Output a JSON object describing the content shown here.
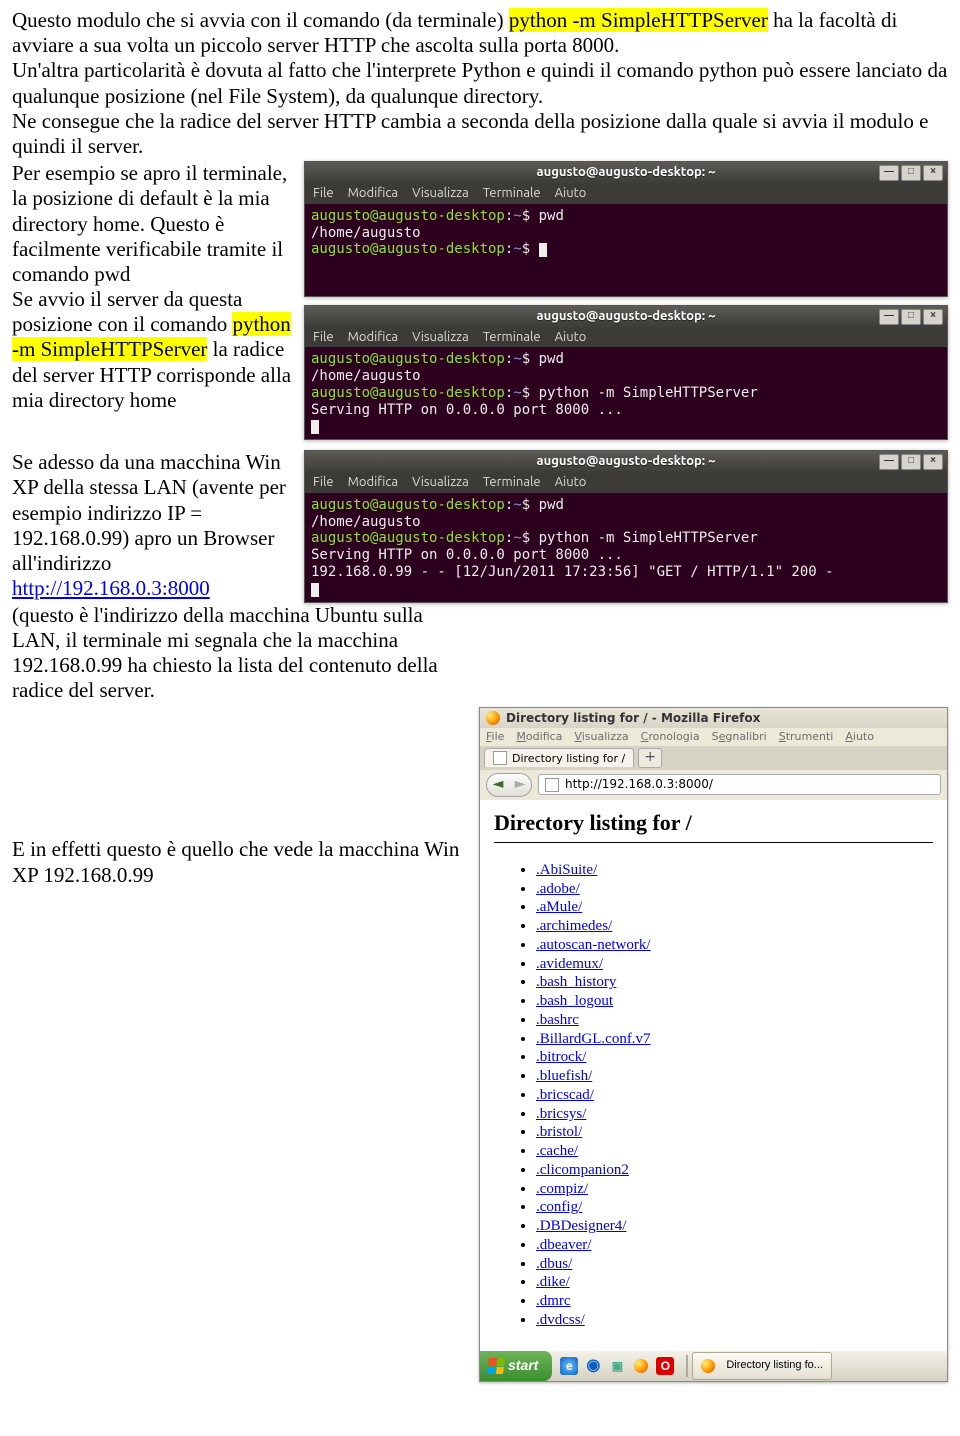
{
  "text": {
    "p1a": "Questo modulo che si avvia con il comando (da terminale) ",
    "p1hl": "python -m SimpleHTTPServer",
    "p1b": " ha la facoltà di avviare a sua volta un piccolo server HTTP che ascolta sulla porta 8000.",
    "p2": "Un'altra particolarità è dovuta al fatto che l'interprete Python e quindi il comando python può essere lanciato da qualunque posizione (nel File System), da qualunque directory.",
    "p3": "Ne consegue che la radice del server HTTP cambia a seconda della posizione dalla quale si avvia il modulo e quindi il server.",
    "p4": "Per esempio se apro il terminale, la posizione di default è la mia directory home. Questo è facilmente verificabile tramite il comando pwd",
    "p5a": "Se avvio il server da questa posizione con il comando ",
    "p5hl": "python -m SimpleHTTPServer",
    "p5b": " la radice del server HTTP corrisponde alla mia directory home",
    "p6a": "Se adesso da una macchina Win XP della stessa LAN (avente per esempio indirizzo IP = 192.168.0.99) apro un Browser all'indirizzo ",
    "p6link": "http://192.168.0.3:8000",
    "p6b": " (questo è l'indirizzo della macchina Ubuntu sulla LAN, il terminale mi segnala che la macchina 192.168.0.99 ha chiesto la lista del contenuto della radice del server.",
    "p7": "E in effetti questo è quello che vede la macchina Win XP 192.168.0.99"
  },
  "terminal": {
    "title": "augusto@augusto-desktop: ~",
    "menu": {
      "file": "File",
      "modifica": "Modifica",
      "visualizza": "Visualizza",
      "terminale": "Terminale",
      "aiuto": "Aiuto"
    },
    "winbtn": {
      "min": "—",
      "max": "□",
      "close": "×"
    },
    "promptUser": "augusto@augusto-desktop",
    "promptPath": "~",
    "dollar": "$",
    "cmd_pwd": "pwd",
    "out_home": "/home/augusto",
    "cmd_py": "python -m SimpleHTTPServer",
    "out_serving": "Serving HTTP on 0.0.0.0 port 8000 ...",
    "out_get": "192.168.0.99 - - [12/Jun/2011 17:23:56] \"GET / HTTP/1.1\" 200 -"
  },
  "firefox": {
    "title": "Directory listing for / - Mozilla Firefox",
    "menu": {
      "file": "File",
      "modifica": "Modifica",
      "visualizza": "Visualizza",
      "cronologia": "Cronologia",
      "segnalibri": "Segnalibri",
      "strumenti": "Strumenti",
      "aiuto": "Aiuto"
    },
    "tab": "Directory listing for /",
    "newtab": "+",
    "back": "◄",
    "fwd": "►",
    "url": "http://192.168.0.3:8000/",
    "heading": "Directory listing for /",
    "listing": [
      ".AbiSuite/",
      ".adobe/",
      ".aMule/",
      ".archimedes/",
      ".autoscan-network/",
      ".avidemux/",
      ".bash_history",
      ".bash_logout",
      ".bashrc",
      ".BillardGL.conf.v7",
      ".bitrock/",
      ".bluefish/",
      ".bricscad/",
      ".bricsys/",
      ".bristol/",
      ".cache/",
      ".clicompanion2",
      ".compiz/",
      ".config/",
      ".DBDesigner4/",
      ".dbeaver/",
      ".dbus/",
      ".dike/",
      ".dmrc",
      ".dvdcss/"
    ]
  },
  "taskbar": {
    "start": "start",
    "task": "Directory listing fo..."
  }
}
